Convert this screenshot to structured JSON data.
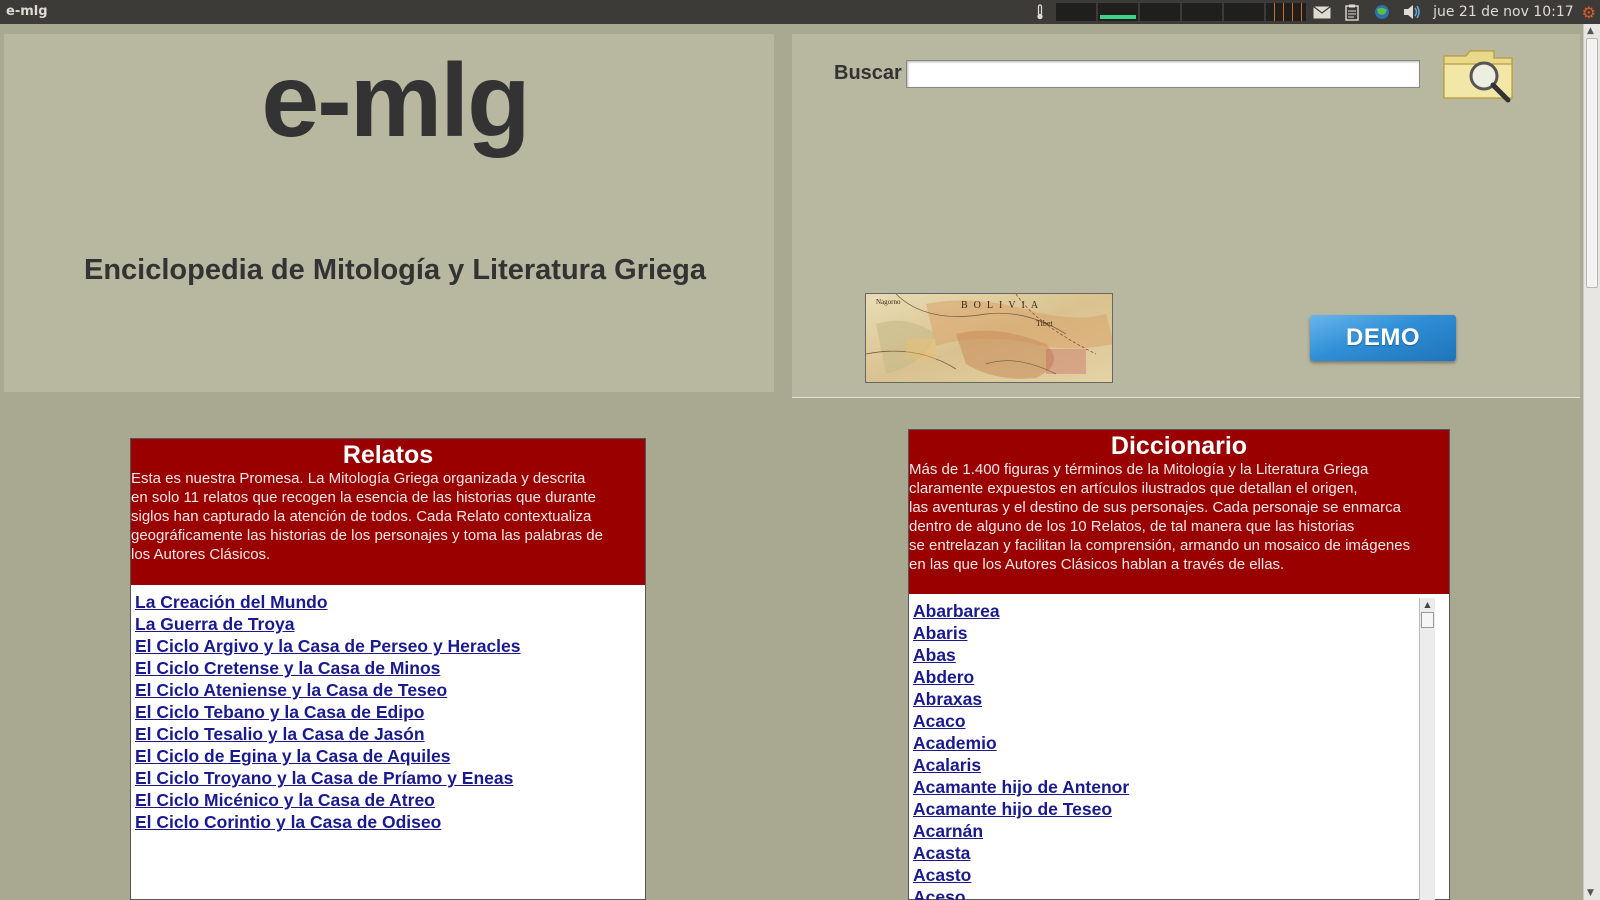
{
  "topbar": {
    "window_title": "e-mlg",
    "clock": "jue 21 de nov  10:17",
    "icons": [
      "temperature-icon",
      "cpu-meter",
      "network-meter",
      "mail-icon",
      "clipboard-icon",
      "network-icon",
      "volume-icon",
      "session-gear-icon"
    ]
  },
  "header": {
    "logo": "e-mlg",
    "subtitle": "Enciclopedia de Mitología y Literatura Griega",
    "search_label": "Buscar",
    "search_value": "",
    "demo_label": "DEMO"
  },
  "relatos": {
    "title": "Relatos",
    "description": "Esta es nuestra Promesa. La Mitología Griega organizada y descrita\nen solo 11 relatos que recogen la esencia de las historias que durante\nsiglos han capturado la atención de todos. Cada Relato contextualiza\ngeográficamente las historias de los personajes y toma las palabras de\nlos Autores Clásicos.",
    "links": [
      "La Creación del Mundo",
      "La Guerra de Troya",
      "El Ciclo Argivo y la Casa de Perseo y Heracles",
      "El Ciclo Cretense y la Casa de Minos",
      "El Ciclo Ateniense y la Casa de Teseo",
      "El Ciclo Tebano y la Casa de Edipo",
      "El Ciclo Tesalio y la Casa de Jasón",
      "El Ciclo de Egina y la Casa de Aquiles",
      "El Ciclo Troyano y la Casa de Príamo y Eneas",
      "El Ciclo Micénico y la Casa de Atreo",
      "El Ciclo Corintio y la Casa de Odiseo"
    ]
  },
  "diccionario": {
    "title": "Diccionario",
    "description": "Más de 1.400 figuras y términos de la Mitología y la Literatura Griega\nclaramente expuestos en artículos ilustrados que detallan el origen,\nlas aventuras y el destino de sus personajes. Cada personaje se enmarca\n dentro de alguno de los 10 Relatos, de tal manera que las historias\nse entrelazan y facilitan la comprensión, armando un mosaico de imágenes\nen las que los Autores Clásicos hablan a través de ellas.",
    "links": [
      "Abarbarea",
      "Abaris",
      "Abas",
      "Abdero",
      "Abraxas",
      "Acaco",
      "Academio",
      "Acalaris",
      "Acamante hijo de Antenor",
      "Acamante hijo de Teseo",
      "Acarnán",
      "Acasta",
      "Acasto",
      "Aceso"
    ]
  },
  "map_labels": [
    "BOLIVIA",
    "Tibet",
    "Nagorno"
  ],
  "colors": {
    "page_bg": "#a9a890",
    "header_bg": "#b8b7a0",
    "panel_head": "#9a0000",
    "link": "#1a1a8f",
    "demo": "#2f8fd6"
  }
}
